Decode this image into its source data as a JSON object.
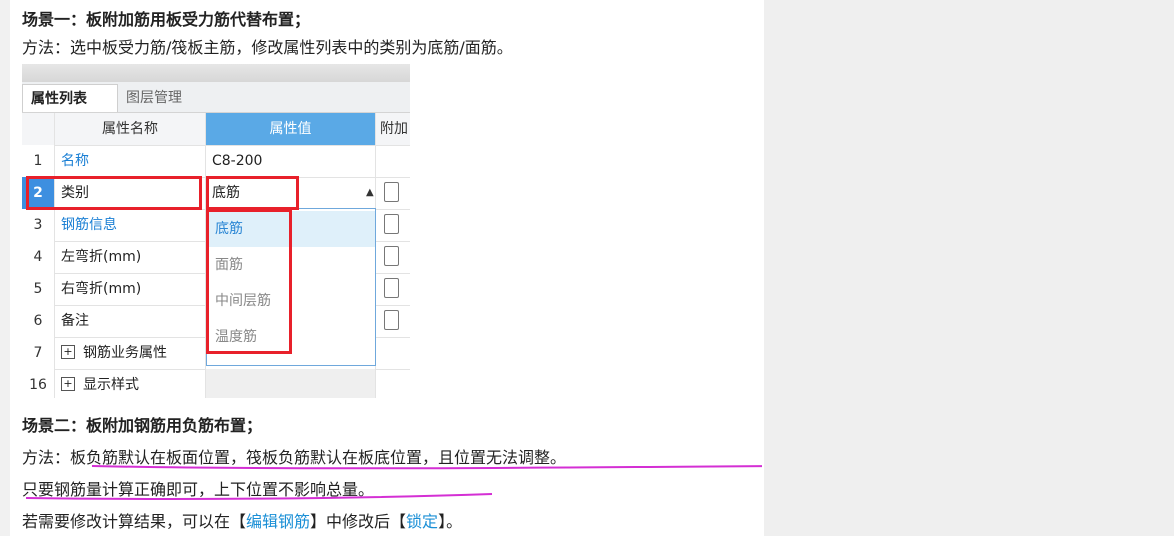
{
  "scene1": {
    "title": "场景一：板附加筋用板受力筋代替布置；",
    "method": "方法：选中板受力筋/筏板主筋，修改属性列表中的类别为底筋/面筋。"
  },
  "panel": {
    "tabs": [
      "属性列表",
      "图层管理"
    ],
    "headers": {
      "name": "属性名称",
      "value": "属性值",
      "extra": "附加"
    },
    "rows": [
      {
        "num": "1",
        "name": "名称",
        "value": "C8-200"
      },
      {
        "num": "2",
        "name": "类别",
        "value": "底筋"
      },
      {
        "num": "3",
        "name": "钢筋信息",
        "value": ""
      },
      {
        "num": "4",
        "name": "左弯折(mm)",
        "value": ""
      },
      {
        "num": "5",
        "name": "右弯折(mm)",
        "value": ""
      },
      {
        "num": "6",
        "name": "备注",
        "value": ""
      },
      {
        "num": "7",
        "name": "钢筋业务属性",
        "value": ""
      },
      {
        "num": "16",
        "name": "显示样式",
        "value": ""
      }
    ],
    "dropdown_options": [
      "底筋",
      "面筋",
      "中间层筋",
      "温度筋"
    ],
    "selected_option": "底筋"
  },
  "scene2": {
    "title": "场景二：板附加钢筋用负筋布置；",
    "method_prefix": "方法：",
    "method_text": "板负筋默认在板面位置，筏板负筋默认在板底位置，且位置无法调整。",
    "line2": "只要钢筋量计算正确即可，上下位置不影响总量。",
    "line3_a": "若需要修改计算结果，可以在【",
    "line3_link1": "编辑钢筋",
    "line3_b": "】中修改后【",
    "line3_link2": "锁定",
    "line3_c": "】。"
  },
  "colors": {
    "accent_blue": "#1a8fd6",
    "highlight_red": "#e8202a",
    "underline_magenta": "#d42fd4"
  }
}
